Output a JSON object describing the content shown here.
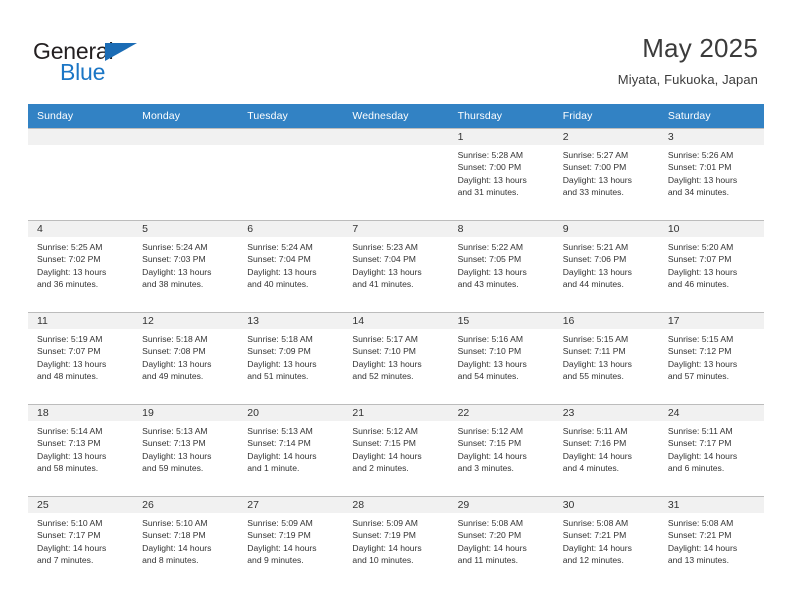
{
  "brand": {
    "name_top": "General",
    "name_bottom": "Blue",
    "accent_color": "#1b76c5",
    "triangle_color": "#1b6cb5"
  },
  "header": {
    "title": "May 2025",
    "subtitle": "Miyata, Fukuoka, Japan"
  },
  "theme": {
    "header_row_bg": "#3282c4",
    "daynum_bg": "#f1f1f1",
    "grid_line": "#bcbcbc",
    "text": "#333333"
  },
  "weekdays": [
    "Sunday",
    "Monday",
    "Tuesday",
    "Wednesday",
    "Thursday",
    "Friday",
    "Saturday"
  ],
  "labels": {
    "sunrise_prefix": "Sunrise:",
    "sunset_prefix": "Sunset:",
    "daylight_prefix": "Daylight:"
  },
  "weeks": [
    [
      {
        "day": "",
        "sunrise": "",
        "sunset": "",
        "daylight_line1": "",
        "daylight_line2": "",
        "empty": true
      },
      {
        "day": "",
        "sunrise": "",
        "sunset": "",
        "daylight_line1": "",
        "daylight_line2": "",
        "empty": true
      },
      {
        "day": "",
        "sunrise": "",
        "sunset": "",
        "daylight_line1": "",
        "daylight_line2": "",
        "empty": true
      },
      {
        "day": "",
        "sunrise": "",
        "sunset": "",
        "daylight_line1": "",
        "daylight_line2": "",
        "empty": true
      },
      {
        "day": "1",
        "sunrise": "Sunrise: 5:28 AM",
        "sunset": "Sunset: 7:00 PM",
        "daylight_line1": "Daylight: 13 hours",
        "daylight_line2": "and 31 minutes.",
        "empty": false
      },
      {
        "day": "2",
        "sunrise": "Sunrise: 5:27 AM",
        "sunset": "Sunset: 7:00 PM",
        "daylight_line1": "Daylight: 13 hours",
        "daylight_line2": "and 33 minutes.",
        "empty": false
      },
      {
        "day": "3",
        "sunrise": "Sunrise: 5:26 AM",
        "sunset": "Sunset: 7:01 PM",
        "daylight_line1": "Daylight: 13 hours",
        "daylight_line2": "and 34 minutes.",
        "empty": false
      }
    ],
    [
      {
        "day": "4",
        "sunrise": "Sunrise: 5:25 AM",
        "sunset": "Sunset: 7:02 PM",
        "daylight_line1": "Daylight: 13 hours",
        "daylight_line2": "and 36 minutes.",
        "empty": false
      },
      {
        "day": "5",
        "sunrise": "Sunrise: 5:24 AM",
        "sunset": "Sunset: 7:03 PM",
        "daylight_line1": "Daylight: 13 hours",
        "daylight_line2": "and 38 minutes.",
        "empty": false
      },
      {
        "day": "6",
        "sunrise": "Sunrise: 5:24 AM",
        "sunset": "Sunset: 7:04 PM",
        "daylight_line1": "Daylight: 13 hours",
        "daylight_line2": "and 40 minutes.",
        "empty": false
      },
      {
        "day": "7",
        "sunrise": "Sunrise: 5:23 AM",
        "sunset": "Sunset: 7:04 PM",
        "daylight_line1": "Daylight: 13 hours",
        "daylight_line2": "and 41 minutes.",
        "empty": false
      },
      {
        "day": "8",
        "sunrise": "Sunrise: 5:22 AM",
        "sunset": "Sunset: 7:05 PM",
        "daylight_line1": "Daylight: 13 hours",
        "daylight_line2": "and 43 minutes.",
        "empty": false
      },
      {
        "day": "9",
        "sunrise": "Sunrise: 5:21 AM",
        "sunset": "Sunset: 7:06 PM",
        "daylight_line1": "Daylight: 13 hours",
        "daylight_line2": "and 44 minutes.",
        "empty": false
      },
      {
        "day": "10",
        "sunrise": "Sunrise: 5:20 AM",
        "sunset": "Sunset: 7:07 PM",
        "daylight_line1": "Daylight: 13 hours",
        "daylight_line2": "and 46 minutes.",
        "empty": false
      }
    ],
    [
      {
        "day": "11",
        "sunrise": "Sunrise: 5:19 AM",
        "sunset": "Sunset: 7:07 PM",
        "daylight_line1": "Daylight: 13 hours",
        "daylight_line2": "and 48 minutes.",
        "empty": false
      },
      {
        "day": "12",
        "sunrise": "Sunrise: 5:18 AM",
        "sunset": "Sunset: 7:08 PM",
        "daylight_line1": "Daylight: 13 hours",
        "daylight_line2": "and 49 minutes.",
        "empty": false
      },
      {
        "day": "13",
        "sunrise": "Sunrise: 5:18 AM",
        "sunset": "Sunset: 7:09 PM",
        "daylight_line1": "Daylight: 13 hours",
        "daylight_line2": "and 51 minutes.",
        "empty": false
      },
      {
        "day": "14",
        "sunrise": "Sunrise: 5:17 AM",
        "sunset": "Sunset: 7:10 PM",
        "daylight_line1": "Daylight: 13 hours",
        "daylight_line2": "and 52 minutes.",
        "empty": false
      },
      {
        "day": "15",
        "sunrise": "Sunrise: 5:16 AM",
        "sunset": "Sunset: 7:10 PM",
        "daylight_line1": "Daylight: 13 hours",
        "daylight_line2": "and 54 minutes.",
        "empty": false
      },
      {
        "day": "16",
        "sunrise": "Sunrise: 5:15 AM",
        "sunset": "Sunset: 7:11 PM",
        "daylight_line1": "Daylight: 13 hours",
        "daylight_line2": "and 55 minutes.",
        "empty": false
      },
      {
        "day": "17",
        "sunrise": "Sunrise: 5:15 AM",
        "sunset": "Sunset: 7:12 PM",
        "daylight_line1": "Daylight: 13 hours",
        "daylight_line2": "and 57 minutes.",
        "empty": false
      }
    ],
    [
      {
        "day": "18",
        "sunrise": "Sunrise: 5:14 AM",
        "sunset": "Sunset: 7:13 PM",
        "daylight_line1": "Daylight: 13 hours",
        "daylight_line2": "and 58 minutes.",
        "empty": false
      },
      {
        "day": "19",
        "sunrise": "Sunrise: 5:13 AM",
        "sunset": "Sunset: 7:13 PM",
        "daylight_line1": "Daylight: 13 hours",
        "daylight_line2": "and 59 minutes.",
        "empty": false
      },
      {
        "day": "20",
        "sunrise": "Sunrise: 5:13 AM",
        "sunset": "Sunset: 7:14 PM",
        "daylight_line1": "Daylight: 14 hours",
        "daylight_line2": "and 1 minute.",
        "empty": false
      },
      {
        "day": "21",
        "sunrise": "Sunrise: 5:12 AM",
        "sunset": "Sunset: 7:15 PM",
        "daylight_line1": "Daylight: 14 hours",
        "daylight_line2": "and 2 minutes.",
        "empty": false
      },
      {
        "day": "22",
        "sunrise": "Sunrise: 5:12 AM",
        "sunset": "Sunset: 7:15 PM",
        "daylight_line1": "Daylight: 14 hours",
        "daylight_line2": "and 3 minutes.",
        "empty": false
      },
      {
        "day": "23",
        "sunrise": "Sunrise: 5:11 AM",
        "sunset": "Sunset: 7:16 PM",
        "daylight_line1": "Daylight: 14 hours",
        "daylight_line2": "and 4 minutes.",
        "empty": false
      },
      {
        "day": "24",
        "sunrise": "Sunrise: 5:11 AM",
        "sunset": "Sunset: 7:17 PM",
        "daylight_line1": "Daylight: 14 hours",
        "daylight_line2": "and 6 minutes.",
        "empty": false
      }
    ],
    [
      {
        "day": "25",
        "sunrise": "Sunrise: 5:10 AM",
        "sunset": "Sunset: 7:17 PM",
        "daylight_line1": "Daylight: 14 hours",
        "daylight_line2": "and 7 minutes.",
        "empty": false
      },
      {
        "day": "26",
        "sunrise": "Sunrise: 5:10 AM",
        "sunset": "Sunset: 7:18 PM",
        "daylight_line1": "Daylight: 14 hours",
        "daylight_line2": "and 8 minutes.",
        "empty": false
      },
      {
        "day": "27",
        "sunrise": "Sunrise: 5:09 AM",
        "sunset": "Sunset: 7:19 PM",
        "daylight_line1": "Daylight: 14 hours",
        "daylight_line2": "and 9 minutes.",
        "empty": false
      },
      {
        "day": "28",
        "sunrise": "Sunrise: 5:09 AM",
        "sunset": "Sunset: 7:19 PM",
        "daylight_line1": "Daylight: 14 hours",
        "daylight_line2": "and 10 minutes.",
        "empty": false
      },
      {
        "day": "29",
        "sunrise": "Sunrise: 5:08 AM",
        "sunset": "Sunset: 7:20 PM",
        "daylight_line1": "Daylight: 14 hours",
        "daylight_line2": "and 11 minutes.",
        "empty": false
      },
      {
        "day": "30",
        "sunrise": "Sunrise: 5:08 AM",
        "sunset": "Sunset: 7:21 PM",
        "daylight_line1": "Daylight: 14 hours",
        "daylight_line2": "and 12 minutes.",
        "empty": false
      },
      {
        "day": "31",
        "sunrise": "Sunrise: 5:08 AM",
        "sunset": "Sunset: 7:21 PM",
        "daylight_line1": "Daylight: 14 hours",
        "daylight_line2": "and 13 minutes.",
        "empty": false
      }
    ]
  ]
}
